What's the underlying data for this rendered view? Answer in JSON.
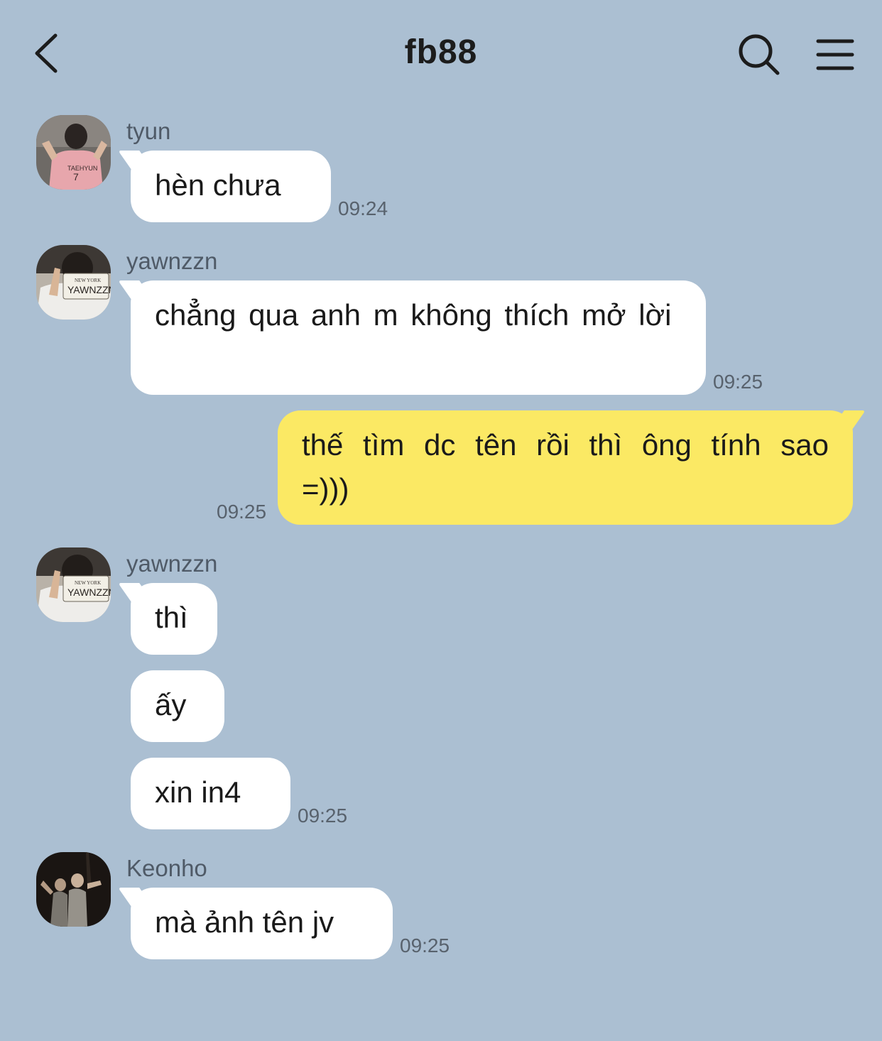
{
  "header": {
    "title": "fb88",
    "back_icon": "chevron-left-icon",
    "search_icon": "search-icon",
    "menu_icon": "hamburger-menu-icon"
  },
  "colors": {
    "background": "#abbfd2",
    "incoming_bubble": "#ffffff",
    "outgoing_bubble": "#fbe964"
  },
  "messages": [
    {
      "sender": "tyun",
      "text": "hèn chưa",
      "time": "09:24"
    },
    {
      "sender": "yawnzzn",
      "text": "chẳng qua anh m không thích mở lời",
      "time": "09:25"
    },
    {
      "sender": "",
      "text": "thế tìm dc tên rồi thì ông tính sao =)))",
      "time": "09:25"
    },
    {
      "sender": "yawnzzn",
      "text": "thì",
      "time": ""
    },
    {
      "sender": "",
      "text": "ấy",
      "time": ""
    },
    {
      "sender": "",
      "text": "xin in4",
      "time": "09:25"
    },
    {
      "sender": "Keonho",
      "text": "mà ảnh tên jv",
      "time": "09:25"
    }
  ]
}
